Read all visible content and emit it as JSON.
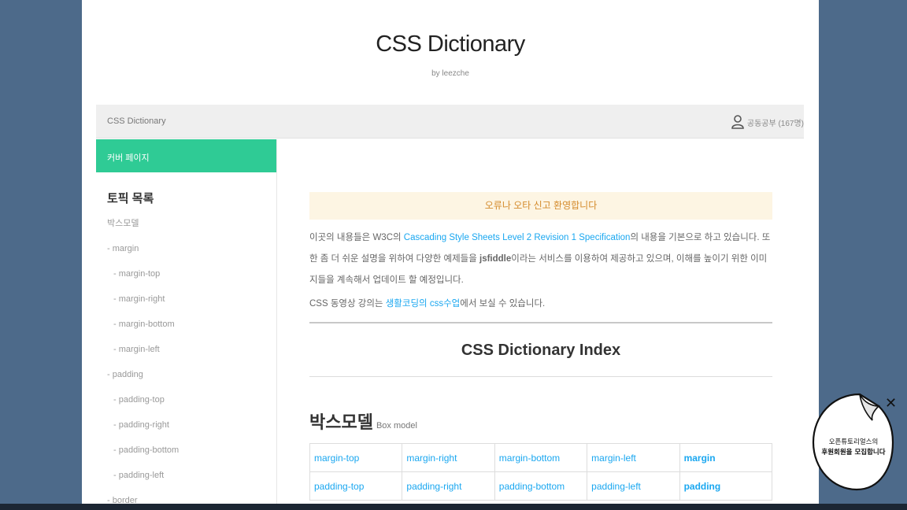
{
  "site": {
    "title": "CSS Dictionary",
    "byline": "by leezche"
  },
  "topbar": {
    "title": "CSS Dictionary",
    "user_label": "공동공부 (167명)"
  },
  "sidebar": {
    "cover_label": "커버 페이지",
    "topic_heading": "토픽 목록",
    "items": [
      {
        "label": "박스모델",
        "level": 1
      },
      {
        "label": "- margin",
        "level": 1
      },
      {
        "label": "- margin-top",
        "level": 2
      },
      {
        "label": "- margin-right",
        "level": 2
      },
      {
        "label": "- margin-bottom",
        "level": 2
      },
      {
        "label": "- margin-left",
        "level": 2
      },
      {
        "label": "- padding",
        "level": 1
      },
      {
        "label": "- padding-top",
        "level": 2
      },
      {
        "label": "- padding-right",
        "level": 2
      },
      {
        "label": "- padding-bottom",
        "level": 2
      },
      {
        "label": "- padding-left",
        "level": 2
      },
      {
        "label": "- border",
        "level": 1
      }
    ]
  },
  "main": {
    "notice": "오류나 오타 신고 환영합니다",
    "intro_before": "이곳의 내용들은 W3C의 ",
    "intro_link": "Cascading Style Sheets Level 2 Revision 1 Specification",
    "intro_middle": "의 내용을 기본으로 하고 있습니다. 또한 좀 더 쉬운 설명을 위하여 다양한 예제들을 ",
    "intro_jsfiddle": "jsfiddle",
    "intro_after": "이라는 서비스를 이용하여 제공하고 있으며, 이해를 높이기 위한 이미지들을 계속해서 업데이트 할 예정입니다.",
    "lecture_before": "CSS 동영상 강의는 ",
    "lecture_link": "생활코딩의 css수업",
    "lecture_after": "에서 보실 수 있습니다.",
    "index_title": "CSS Dictionary Index",
    "box_heading": "박스모델",
    "box_subheading": "Box model",
    "table_rows": [
      [
        "margin-top",
        "margin-right",
        "margin-bottom",
        "margin-left",
        "margin"
      ],
      [
        "padding-top",
        "padding-right",
        "padding-bottom",
        "padding-left",
        "padding"
      ]
    ]
  },
  "popup": {
    "line1": "오픈튜토리얼스의",
    "line2": "후원회원을 모집합니다"
  },
  "colors": {
    "accent": "#2fcb95",
    "link": "#1aa7f0",
    "notice_bg": "#fdf5e3",
    "backdrop": "#4d6a8a"
  }
}
